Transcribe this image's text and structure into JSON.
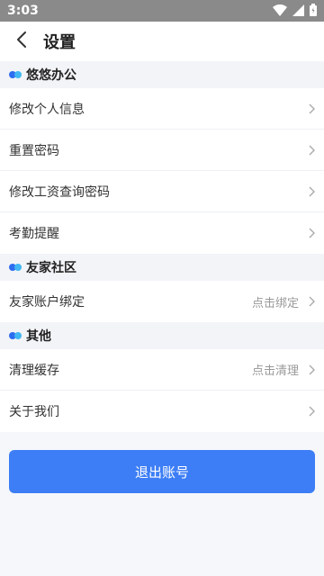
{
  "status_bar": {
    "time": "3:03",
    "icons": [
      "wifi-icon",
      "signal-icon",
      "battery-icon"
    ]
  },
  "header": {
    "title": "设置",
    "back_icon": "back-arrow-icon"
  },
  "sections": [
    {
      "title": "悠悠办公",
      "items": [
        {
          "label": "修改个人信息"
        },
        {
          "label": "重置密码"
        },
        {
          "label": "修改工资查询密码"
        },
        {
          "label": "考勤提醒"
        }
      ]
    },
    {
      "title": "友家社区",
      "items": [
        {
          "label": "友家账户绑定",
          "hint": "点击绑定"
        }
      ]
    },
    {
      "title": "其他",
      "items": [
        {
          "label": "清理缓存",
          "hint": "点击清理"
        },
        {
          "label": "关于我们"
        }
      ]
    }
  ],
  "logout": {
    "label": "退出账号"
  },
  "colors": {
    "primary": "#3d7ef6",
    "dot_dark": "#2d6cf0",
    "dot_light": "#41b6f3",
    "status_bar": "#8a8a8a"
  }
}
